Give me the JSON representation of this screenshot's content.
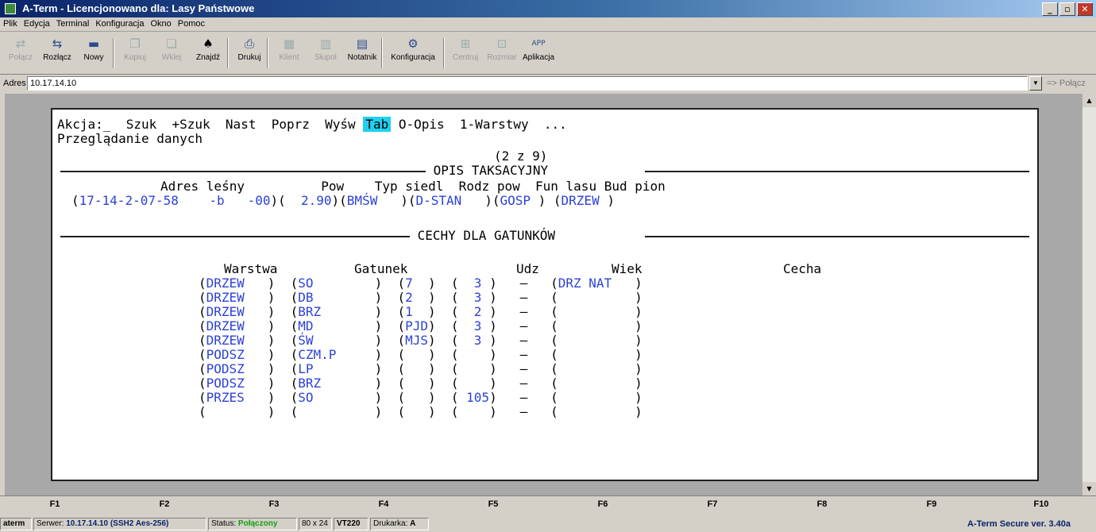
{
  "window": {
    "title": "A-Term - Licencjonowano dla: Lasy Państwowe"
  },
  "menu": [
    "Plik",
    "Edycja",
    "Terminal",
    "Konfiguracja",
    "Okno",
    "Pomoc"
  ],
  "toolbar": {
    "connect": "Połącz",
    "disconnect": "Rozłącz",
    "new": "Nowy",
    "copy": "Kopiuj",
    "paste": "Wklej",
    "find": "Znajdź",
    "print": "Drukuj",
    "client": "Klient",
    "server": "Słupol",
    "notepad": "Notatnik",
    "config": "Konfiguracja",
    "center": "Centruj",
    "size": "Rozmiar",
    "application": "Aplikacja",
    "app_icon_text": "APP"
  },
  "address": {
    "label": "Adres",
    "value": "10.17.14.10",
    "connect": "=> Połącz"
  },
  "terminal": {
    "menu_line": "Akcja:_  Szuk  +Szuk  Nast  Poprz  Wyśw ",
    "menu_selected": "Tab",
    "menu_after": " O-Opis  1-Warstwy  ...",
    "subtitle": "Przeglądanie danych",
    "counter": "(2 z 9)",
    "section1": " OPIS TAKSACYJNY ",
    "hdr1": "Adres leśny          Pow    Typ siedl  Rodz pow  Fun lasu Bud pion",
    "val1_open": "(",
    "val1_address": "17-14-2-07-58    -b   -00",
    "val1_mid": ")(  ",
    "val1_pow": "2.90",
    "val1_typ_open": ")(",
    "val1_typ": "BMŚW",
    "val1_rodz_open": "   )(",
    "val1_rodz": "D-STAN",
    "val1_fun_open": "   )(",
    "val1_fun": "GOSP",
    "val1_bud_open": " ) (",
    "val1_bud": "DRZEW",
    "val1_close": " )",
    "section2": " CECHY DLA GATUNKÓW ",
    "col_warstwa": "Warstwa",
    "col_gatunek": "Gatunek",
    "col_udz": "Udz",
    "col_wiek": "Wiek",
    "col_cecha": "Cecha",
    "rows": [
      {
        "w": "DRZEW",
        "g": "SO",
        "u": "7",
        "a": " 3",
        "c": "DRZ NAT"
      },
      {
        "w": "DRZEW",
        "g": "DB",
        "u": "2",
        "a": " 3",
        "c": ""
      },
      {
        "w": "DRZEW",
        "g": "BRZ",
        "u": "1",
        "a": " 2",
        "c": ""
      },
      {
        "w": "DRZEW",
        "g": "MD",
        "u": "PJD",
        "a": " 3",
        "c": ""
      },
      {
        "w": "DRZEW",
        "g": "ŚW",
        "u": "MJS",
        "a": " 3",
        "c": ""
      },
      {
        "w": "PODSZ",
        "g": "CZM.P",
        "u": "",
        "a": "",
        "c": ""
      },
      {
        "w": "PODSZ",
        "g": "LP",
        "u": "",
        "a": "",
        "c": ""
      },
      {
        "w": "PODSZ",
        "g": "BRZ",
        "u": "",
        "a": "",
        "c": ""
      },
      {
        "w": "PRZES",
        "g": "SO",
        "u": "",
        "a": "105",
        "c": ""
      },
      {
        "w": "",
        "g": "",
        "u": "",
        "a": "",
        "c": ""
      }
    ]
  },
  "fkeys": [
    "F1",
    "F2",
    "F3",
    "F4",
    "F5",
    "F6",
    "F7",
    "F8",
    "F9",
    "F10"
  ],
  "status": {
    "app": "aterm",
    "server_label": "Serwer:",
    "server_value": "10.17.14.10 (SSH2 Aes-256)",
    "status_label": "Status:",
    "status_value": "Połączony",
    "dims": "80 x 24",
    "emulation": "VT220",
    "printer_label": "Drukarka:",
    "printer_value": "A",
    "version": "A-Term Secure ver. 3.40a"
  }
}
